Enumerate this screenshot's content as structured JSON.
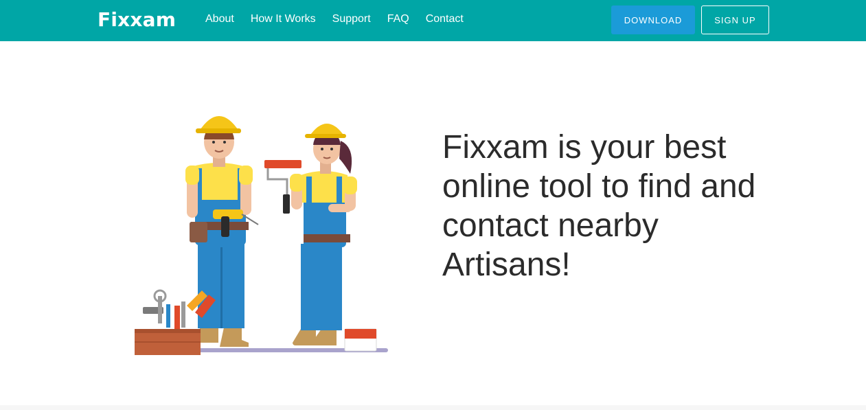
{
  "nav": {
    "brand": "Fixxam",
    "links": [
      "About",
      "How It Works",
      "Support",
      "FAQ",
      "Contact"
    ],
    "download_label": "DOWNLOAD",
    "signup_label": "SIGN UP"
  },
  "hero": {
    "headline": "Fixxam is your best online tool to find and contact nearby Artisans!"
  },
  "colors": {
    "navbar": "#00a6a6",
    "download_button": "#1b9bd8",
    "text": "#2b2b2b"
  }
}
